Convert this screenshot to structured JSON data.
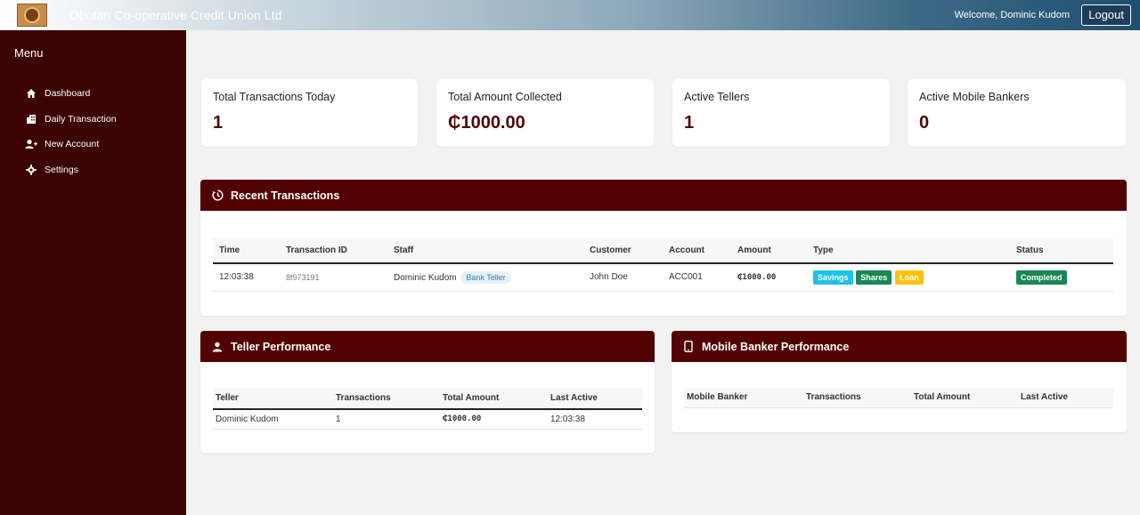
{
  "header": {
    "app_title": "Obotan Co-operative Credit Union Ltd",
    "welcome": "Welcome, Dominic Kudom",
    "logout_label": "Logout"
  },
  "sidebar": {
    "title": "Menu",
    "items": [
      {
        "label": "Dashboard",
        "icon": "home-icon"
      },
      {
        "label": "Daily Transaction",
        "icon": "building-icon"
      },
      {
        "label": "New Account",
        "icon": "user-plus-icon"
      },
      {
        "label": "Settings",
        "icon": "gear-icon"
      }
    ]
  },
  "stats": [
    {
      "label": "Total Transactions Today",
      "value": "1"
    },
    {
      "label": "Total Amount Collected",
      "value": "₵1000.00"
    },
    {
      "label": "Active Tellers",
      "value": "1"
    },
    {
      "label": "Active Mobile Bankers",
      "value": "0"
    }
  ],
  "recent": {
    "title": "Recent Transactions",
    "columns": [
      "Time",
      "Transaction ID",
      "Staff",
      "Customer",
      "Account",
      "Amount",
      "Type",
      "Status"
    ],
    "rows": [
      {
        "time": "12:03:38",
        "id": "8f973191",
        "staff": "Dominic Kudom",
        "staff_role": "Bank Teller",
        "customer": "John Doe",
        "account": "ACC001",
        "amount": "₵1000.00",
        "types": [
          "Savings",
          "Shares",
          "Loan"
        ],
        "status": "Completed"
      }
    ]
  },
  "teller": {
    "title": "Teller Performance",
    "columns": [
      "Teller",
      "Transactions",
      "Total Amount",
      "Last Active"
    ],
    "rows": [
      {
        "name": "Dominic Kudom",
        "transactions": "1",
        "total": "₵1000.00",
        "last_active": "12:03:38"
      }
    ]
  },
  "mobile": {
    "title": "Mobile Banker Performance",
    "columns": [
      "Mobile Banker",
      "Transactions",
      "Total Amount",
      "Last Active"
    ]
  }
}
